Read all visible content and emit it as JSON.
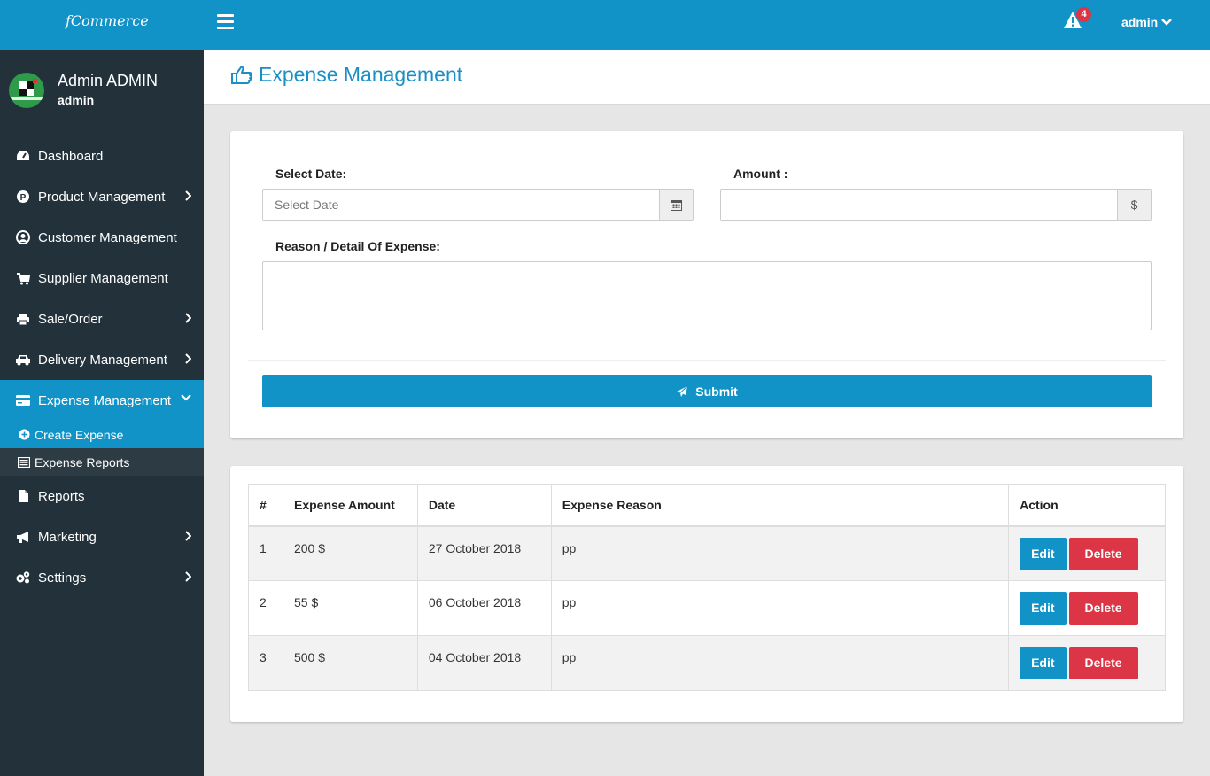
{
  "topbar": {
    "brand": "fCommerce",
    "notification_count": "4",
    "user_menu_label": "admin"
  },
  "sidebar": {
    "user_name": "Admin ADMIN",
    "user_role": "admin",
    "items": [
      {
        "label": "Dashboard",
        "icon": "dashboard-icon",
        "has_submenu": false
      },
      {
        "label": "Product Management",
        "icon": "product-icon",
        "has_submenu": true
      },
      {
        "label": "Customer Management",
        "icon": "user-circle-icon",
        "has_submenu": false
      },
      {
        "label": "Supplier Management",
        "icon": "cart-icon",
        "has_submenu": false
      },
      {
        "label": "Sale/Order",
        "icon": "print-icon",
        "has_submenu": true
      },
      {
        "label": "Delivery Management",
        "icon": "car-icon",
        "has_submenu": true
      },
      {
        "label": "Expense Management",
        "icon": "credit-card-icon",
        "has_submenu": true,
        "active": true
      },
      {
        "label": "Reports",
        "icon": "file-icon",
        "has_submenu": false
      },
      {
        "label": "Marketing",
        "icon": "bullhorn-icon",
        "has_submenu": true
      },
      {
        "label": "Settings",
        "icon": "cogs-icon",
        "has_submenu": true
      }
    ],
    "subitems": [
      {
        "label": "Create Expense",
        "icon": "plus-circle-icon",
        "active": true
      },
      {
        "label": "Expense Reports",
        "icon": "list-icon"
      }
    ]
  },
  "page": {
    "title": "Expense Management"
  },
  "form": {
    "date_label": "Select Date:",
    "date_placeholder": "Select Date",
    "date_value": "",
    "amount_label": "Amount :",
    "amount_value": "",
    "amount_addon": "$",
    "reason_label": "Reason / Detail Of Expense:",
    "reason_value": "",
    "submit_label": "Submit"
  },
  "table": {
    "headers": [
      "#",
      "Expense Amount",
      "Date",
      "Expense Reason",
      "Action"
    ],
    "rows": [
      {
        "num": "1",
        "amount": "200 $",
        "date": "27 October 2018",
        "reason": "pp"
      },
      {
        "num": "2",
        "amount": "55 $",
        "date": "06 October 2018",
        "reason": "pp"
      },
      {
        "num": "3",
        "amount": "500 $",
        "date": "04 October 2018",
        "reason": "pp"
      }
    ],
    "edit_label": "Edit",
    "delete_label": "Delete"
  },
  "colors": {
    "primary": "#1193c8",
    "sidebar": "#22313a",
    "danger": "#dc3545"
  }
}
